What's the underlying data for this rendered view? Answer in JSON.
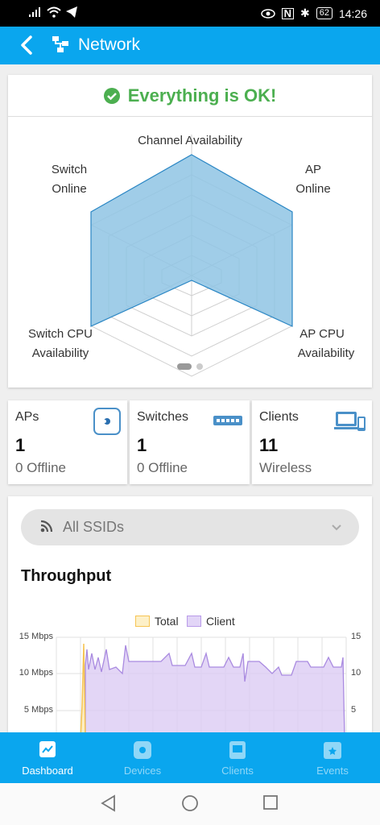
{
  "statusbar": {
    "battery": "62",
    "time": "14:26"
  },
  "appbar": {
    "title": "Network"
  },
  "status_card": {
    "ok_text": "Everything is OK!",
    "radar_labels": {
      "top": "Channel Availability",
      "upper_left_1": "Switch",
      "upper_left_2": "Online",
      "upper_right_1": "AP",
      "upper_right_2": "Online",
      "lower_left_1": "Switch CPU",
      "lower_left_2": "Availability",
      "lower_right_1": "AP CPU",
      "lower_right_2": "Availability"
    }
  },
  "stats": {
    "aps": {
      "name": "APs",
      "count": "1",
      "sub": "0 Offline"
    },
    "switches": {
      "name": "Switches",
      "count": "1",
      "sub": "0 Offline"
    },
    "clients": {
      "name": "Clients",
      "count": "11",
      "sub": "Wireless"
    }
  },
  "throughput": {
    "ssid_select": "All SSIDs",
    "title": "Throughput",
    "legend_total": "Total",
    "legend_client": "Client",
    "left_ticks": [
      "15 Mbps",
      "10 Mbps",
      "5 Mbps"
    ],
    "right_ticks": [
      "15",
      "10",
      "5"
    ]
  },
  "bottomnav": {
    "tabs": [
      "Dashboard",
      "Devices",
      "Clients",
      "Events"
    ]
  },
  "colors": {
    "accent": "#0aa6ee",
    "ok": "#4caf50",
    "client": "#b99be9",
    "total": "#f6c453"
  }
}
